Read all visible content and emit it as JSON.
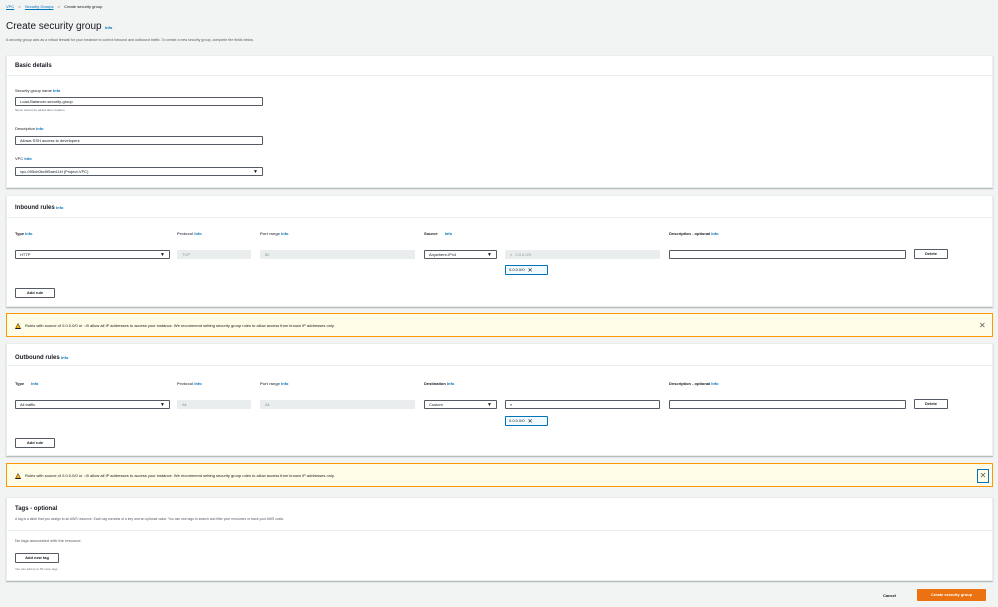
{
  "breadcrumb": {
    "vpc": "VPC",
    "security_groups": "Security Groups",
    "current": "Create security group",
    "sep": ">"
  },
  "page": {
    "title": "Create security group",
    "info": "Info",
    "description": "A security group acts as a virtual firewall for your instance to control inbound and outbound traffic. To create a new security group, complete the fields below."
  },
  "basic": {
    "heading": "Basic details",
    "name_label": "Security group name",
    "name_value": "Load-Balancer-security-group",
    "name_hint": "Name cannot be edited after creation.",
    "desc_label": "Description",
    "desc_value": "Allows SSH access to developers",
    "vpc_label": "VPC",
    "vpc_value": "vpc-095cb0bc5f5ae414f (Project-VPC)"
  },
  "inbound": {
    "heading": "Inbound rules",
    "col_type": "Type",
    "col_protocol": "Protocol",
    "col_port": "Port range",
    "col_source": "Source",
    "col_desc": "Description - optional",
    "type_value": "HTTP",
    "protocol_value": "TCP",
    "port_value": "80",
    "source_value": "Anywhere-IPv4",
    "search_value": "0.0.0.0/0",
    "chip": "0.0.0.0/0",
    "delete": "Delete",
    "add_rule": "Add rule"
  },
  "warning_text": "Rules with source of 0.0.0.0/0 or ::/0 allow all IP addresses to access your instance. We recommend setting security group rules to allow access from known IP addresses only.",
  "outbound": {
    "heading": "Outbound rules",
    "col_type": "Type",
    "col_protocol": "Protocol",
    "col_port": "Port range",
    "col_dest": "Destination",
    "col_desc": "Description - optional",
    "type_value": "All traffic",
    "protocol_value": "All",
    "port_value": "All",
    "dest_value": "Custom",
    "chip": "0.0.0.0/0",
    "delete": "Delete",
    "add_rule": "Add rule"
  },
  "tags": {
    "heading": "Tags - optional",
    "description": "A tag is a label that you assign to an AWS resource. Each tag consists of a key and an optional value. You can use tags to search and filter your resources or track your AWS costs.",
    "empty": "No tags associated with the resource.",
    "add_tag": "Add new tag",
    "hint": "You can add up to 50 more tags"
  },
  "footer": {
    "cancel": "Cancel",
    "create": "Create security group"
  },
  "icons": {
    "caret": "▼",
    "close": "✕",
    "search": "⌕"
  },
  "colors": {
    "link": "#0073bb",
    "primary": "#ec7211",
    "warning_border": "#ff9900",
    "chip_border": "#0073bb"
  }
}
